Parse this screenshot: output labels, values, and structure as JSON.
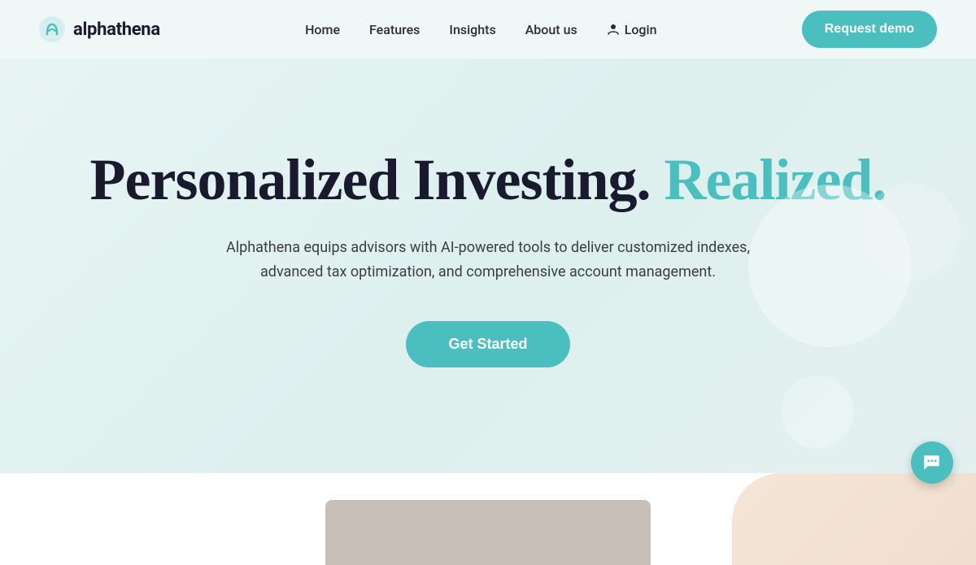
{
  "nav": {
    "logo_text": "alphathena",
    "links": [
      {
        "label": "Home",
        "id": "home"
      },
      {
        "label": "Features",
        "id": "features"
      },
      {
        "label": "Insights",
        "id": "insights"
      },
      {
        "label": "About us",
        "id": "about"
      }
    ],
    "login_label": "Login",
    "request_demo_label": "Request demo"
  },
  "hero": {
    "title_part1": "Personalized Investing.",
    "title_part2": "Realized.",
    "subtitle": "Alphathena equips advisors with AI-powered tools to deliver customized indexes, advanced tax optimization, and comprehensive account management.",
    "cta_label": "Get Started"
  },
  "chat": {
    "label": "Chat support"
  },
  "colors": {
    "accent": "#4bbfbf",
    "dark": "#1a1a2e",
    "text": "#2d2d2d"
  }
}
